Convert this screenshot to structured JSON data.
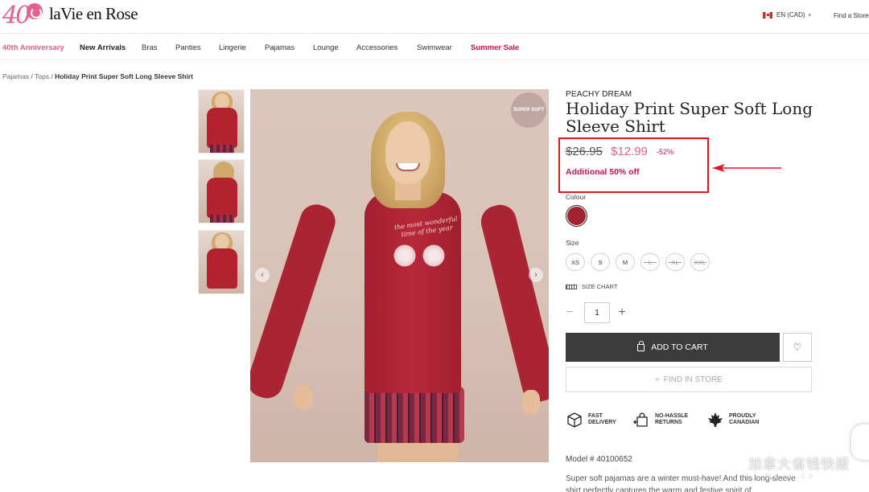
{
  "header": {
    "logo_number": "40",
    "logo_text": "laVie en Rose",
    "locale": "EN (CAD)",
    "find_store": "Find a Store"
  },
  "nav": {
    "items": [
      {
        "label": "40th Anniversary"
      },
      {
        "label": "New Arrivals"
      },
      {
        "label": "Bras"
      },
      {
        "label": "Panties"
      },
      {
        "label": "Lingerie"
      },
      {
        "label": "Pajamas"
      },
      {
        "label": "Lounge"
      },
      {
        "label": "Accessories"
      },
      {
        "label": "Swimwear"
      },
      {
        "label": "Summer Sale"
      }
    ]
  },
  "breadcrumb": {
    "items": [
      "Pajamas",
      "Tops"
    ],
    "separator": " / ",
    "current": "Holiday Print Super Soft Long Sleeve Shirt"
  },
  "gallery": {
    "badge": "SUPER SOFT",
    "shirt_text": "the most wonderful time of the year",
    "prev_icon": "‹",
    "next_icon": "›"
  },
  "product": {
    "brand": "PEACHY DREAM",
    "title": "Holiday Print Super Soft Long Sleeve Shirt",
    "old_price": "$26.95",
    "new_price": "$12.99",
    "discount": "-52%",
    "additional": "Additional 50% off",
    "colour_label": "Colour",
    "size_label": "Size",
    "sizes": [
      {
        "label": "XS",
        "available": true
      },
      {
        "label": "S",
        "available": true
      },
      {
        "label": "M",
        "available": true
      },
      {
        "label": "L",
        "available": false
      },
      {
        "label": "XL",
        "available": false
      },
      {
        "label": "XXL",
        "available": false
      }
    ],
    "size_chart": "SIZE CHART",
    "quantity": "1",
    "qty_minus": "−",
    "qty_plus": "+",
    "add_to_cart": "ADD TO CART",
    "find_in_store": "FIND IN STORE",
    "features": [
      {
        "line1": "FAST",
        "line2": "DELIVERY",
        "icon": "box-icon"
      },
      {
        "line1": "NO-HASSLE",
        "line2": "RETURNS",
        "icon": "return-bag-icon"
      },
      {
        "line1": "PROUDLY",
        "line2": "CANADIAN",
        "icon": "maple-leaf-icon"
      }
    ],
    "model": "Model # 40100652",
    "description": "Super soft pajamas are a winter must-have! And this long-sleeve shirt perfectly captures the warm and festive spirit of"
  },
  "colors": {
    "brand_pink": "#e6608c",
    "sale_red": "#d0104c",
    "swatch": "#a1232f",
    "highlight": "#e8121c"
  },
  "watermark": {
    "text": "加拿大省钱快报",
    "sub": "moon.ca"
  }
}
